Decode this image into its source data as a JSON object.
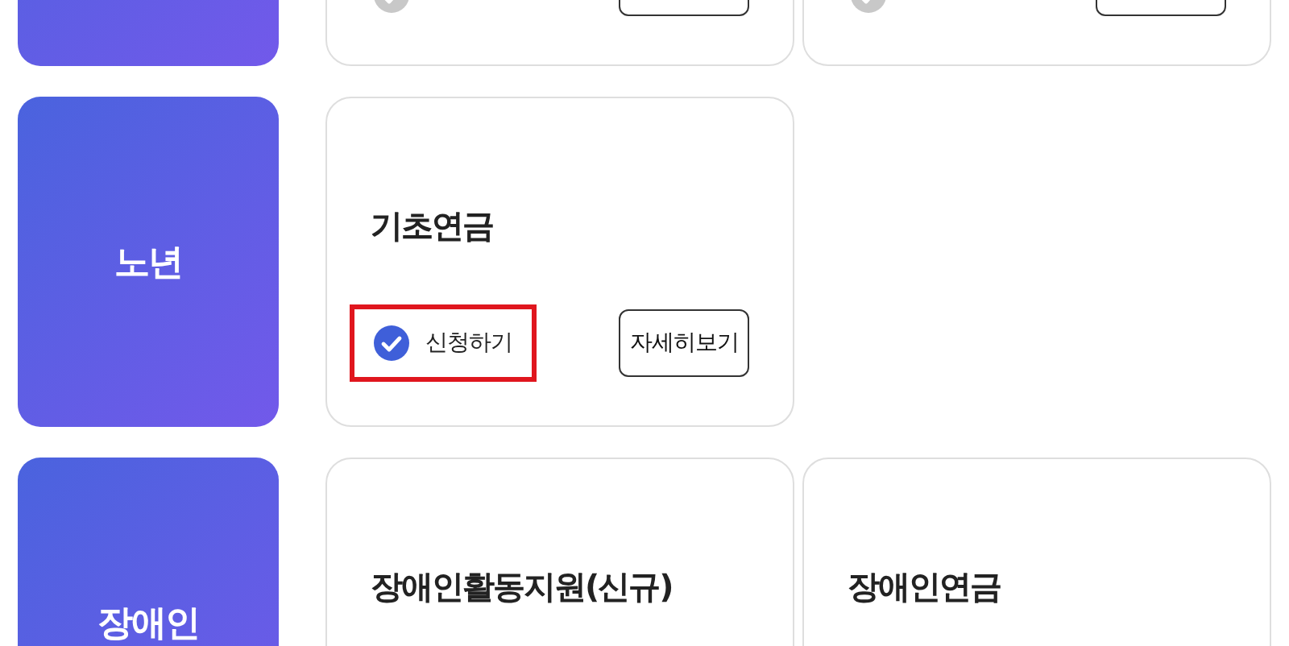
{
  "rows": [
    {
      "cards": [
        {
          "kind": "cut"
        },
        {
          "kind": "cut"
        }
      ]
    },
    {
      "category": "노년",
      "cards": [
        {
          "title": "기초연금",
          "apply_label": "신청하기",
          "checked": true,
          "highlighted": true,
          "details_button": "자세히보기"
        }
      ]
    },
    {
      "category": "장애인",
      "cards": [
        {
          "title": "장애인활동지원(신규)"
        },
        {
          "title": "장애인연금"
        }
      ]
    }
  ]
}
